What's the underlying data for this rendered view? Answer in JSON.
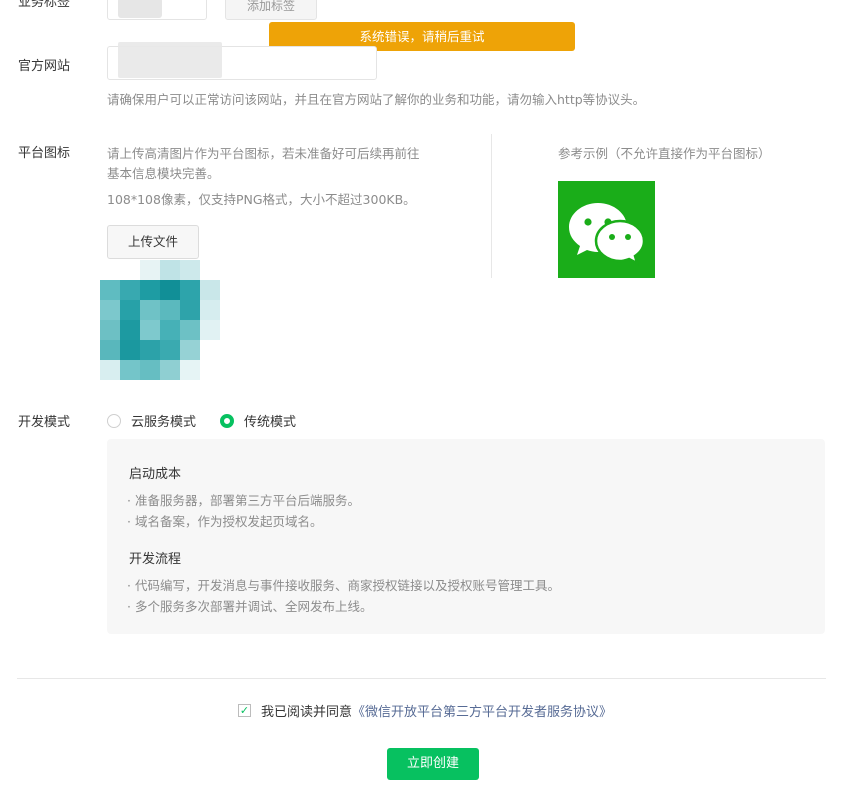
{
  "top_row": {
    "label": "业务标签",
    "button_label": "添加标签"
  },
  "toast": {
    "text": "系统错误，请稍后重试",
    "color": "#eea307"
  },
  "website": {
    "label": "官方网站",
    "value": "",
    "hint": "请确保用户可以正常访问该网站，并且在官方网站了解你的业务和功能，请勿输入http等协议头。"
  },
  "platform_icon": {
    "label": "平台图标",
    "desc_line1": "请上传高清图片作为平台图标，若未准备好可后续再前往",
    "desc_line2": "基本信息模块完善。",
    "spec": "108*108像素，仅支持PNG格式，大小不超过300KB。",
    "upload_label": "上传文件",
    "reference_title": "参考示例（不允许直接作为平台图标）",
    "reference_icon": "wechat-logo-icon"
  },
  "dev_mode": {
    "label": "开发模式",
    "options": [
      {
        "label": "云服务模式",
        "selected": false
      },
      {
        "label": "传统模式",
        "selected": true
      }
    ],
    "info": {
      "cost_title": "启动成本",
      "cost_items": [
        "·  准备服务器，部署第三方平台后端服务。",
        "·  域名备案，作为授权发起页域名。"
      ],
      "flow_title": "开发流程",
      "flow_items": [
        "·  代码编写，开发消息与事件接收服务、商家授权链接以及授权账号管理工具。",
        "·  多个服务多次部署并调试、全网发布上线。"
      ]
    }
  },
  "agreement": {
    "checked": true,
    "text": "我已阅读并同意",
    "link": "《微信开放平台第三方平台开发者服务协议》"
  },
  "submit_label": "立即创建",
  "colors": {
    "accent": "#07c160",
    "link": "#576b95",
    "hint": "#8c8c8c",
    "wechat": "#1aad19"
  }
}
